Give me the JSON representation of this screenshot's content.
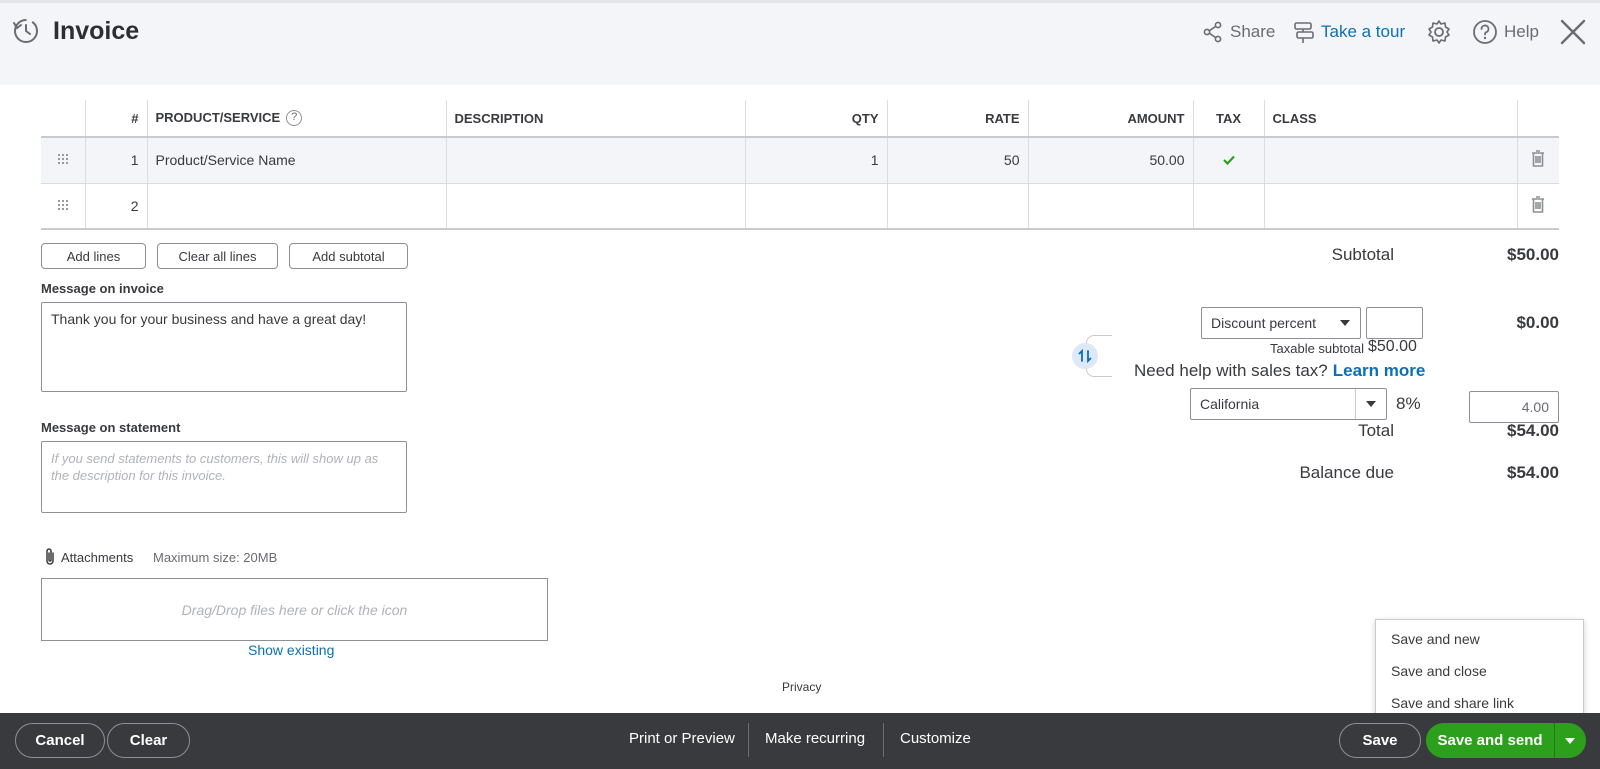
{
  "header": {
    "title": "Invoice",
    "share": "Share",
    "tour": "Take a tour",
    "help": "Help"
  },
  "table": {
    "headers": [
      "#",
      "PRODUCT/SERVICE",
      "DESCRIPTION",
      "QTY",
      "RATE",
      "AMOUNT",
      "TAX",
      "CLASS"
    ],
    "rows": [
      {
        "num": "1",
        "product": "Product/Service Name",
        "description": "",
        "qty": "1",
        "rate": "50",
        "amount": "50.00",
        "tax": true,
        "class": ""
      },
      {
        "num": "2",
        "product": "",
        "description": "",
        "qty": "",
        "rate": "",
        "amount": "",
        "tax": false,
        "class": ""
      }
    ]
  },
  "buttons": {
    "add_lines": "Add lines",
    "clear_all": "Clear all lines",
    "add_subtotal": "Add subtotal"
  },
  "message_invoice": {
    "label": "Message on invoice",
    "value": "Thank you for your business and have a great day!"
  },
  "message_statement": {
    "label": "Message on statement",
    "placeholder": "If you send statements to customers, this will show up as the description for this invoice."
  },
  "attachments": {
    "label": "Attachments",
    "max_size": "Maximum size: 20MB",
    "drop_text": "Drag/Drop files here or click the icon",
    "show_existing": "Show existing"
  },
  "totals": {
    "subtotal_label": "Subtotal",
    "subtotal_value": "$50.00",
    "discount_select": "Discount percent",
    "discount_value": "$0.00",
    "taxable_label": "Taxable subtotal",
    "taxable_value": "$50.00",
    "sales_tax_help": "Need help with sales tax?",
    "learn_more": "Learn more",
    "tax_region": "California",
    "tax_rate": "8%",
    "tax_amount": "4.00",
    "total_label": "Total",
    "total_value": "$54.00",
    "balance_label": "Balance due",
    "balance_value": "$54.00"
  },
  "privacy": "Privacy",
  "save_menu": {
    "items": [
      "Save and new",
      "Save and close",
      "Save and share link"
    ]
  },
  "footer": {
    "cancel": "Cancel",
    "clear": "Clear",
    "print_preview": "Print or Preview",
    "make_recurring": "Make recurring",
    "customize": "Customize",
    "save": "Save",
    "save_and_send": "Save and send"
  },
  "colors": {
    "accent_blue": "#0d6fb5",
    "green": "#2ca01c",
    "footer_bg": "#393a3d",
    "header_bg": "#f4f5f8"
  }
}
